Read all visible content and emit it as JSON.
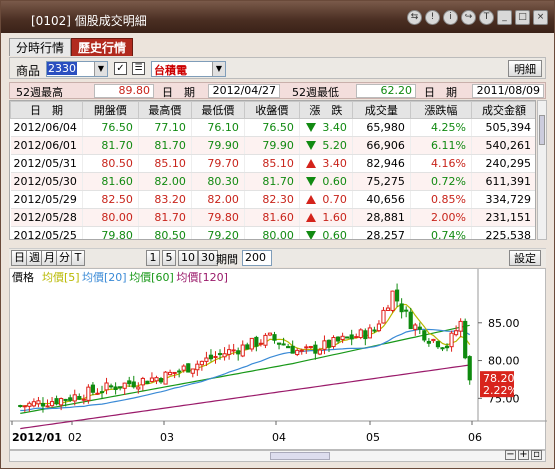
{
  "window": {
    "title": "[0102] 個股成交明細",
    "buttons": [
      "⇆",
      "!",
      "i",
      "↪",
      "T",
      "_",
      "□",
      "×"
    ]
  },
  "tabs": [
    {
      "label": "分時行情",
      "active": false
    },
    {
      "label": "歷史行情",
      "active": true
    }
  ],
  "quote": {
    "stock_label": "商品",
    "stock_code": "2330",
    "stock_name": "台積電",
    "details_button": "明細",
    "checkbox": "✓"
  },
  "stats": {
    "high_label": "52週最高",
    "high_value": "89.80",
    "high_date_label": "日　期",
    "high_date": "2012/04/27",
    "low_label": "52週最低",
    "low_value": "62.20",
    "low_date_label": "日　期",
    "low_date": "2011/08/09"
  },
  "table": {
    "headers": [
      "日　期",
      "開盤價",
      "最高價",
      "最低價",
      "收盤價",
      "漲　跌",
      "成交量",
      "漲跌幅",
      "成交金額"
    ],
    "rows": [
      {
        "date": "2012/06/04",
        "open": "76.50",
        "high": "77.10",
        "low": "76.10",
        "close": "76.50",
        "dir": "down",
        "chg": "3.40",
        "vol": "65,980",
        "pct": "4.25%",
        "amt": "505,394"
      },
      {
        "date": "2012/06/01",
        "open": "81.70",
        "high": "81.70",
        "low": "79.90",
        "close": "79.90",
        "dir": "down",
        "chg": "5.20",
        "vol": "66,906",
        "pct": "6.11%",
        "amt": "540,261"
      },
      {
        "date": "2012/05/31",
        "open": "80.50",
        "high": "85.10",
        "low": "79.70",
        "close": "85.10",
        "dir": "up",
        "chg": "3.40",
        "vol": "82,946",
        "pct": "4.16%",
        "amt": "240,295"
      },
      {
        "date": "2012/05/30",
        "open": "81.60",
        "high": "82.00",
        "low": "80.30",
        "close": "81.70",
        "dir": "down",
        "chg": "0.60",
        "vol": "75,275",
        "pct": "0.72%",
        "amt": "611,391"
      },
      {
        "date": "2012/05/29",
        "open": "82.50",
        "high": "83.20",
        "low": "82.00",
        "close": "82.30",
        "dir": "up",
        "chg": "0.70",
        "vol": "40,656",
        "pct": "0.85%",
        "amt": "334,729"
      },
      {
        "date": "2012/05/28",
        "open": "80.00",
        "high": "81.70",
        "low": "79.80",
        "close": "81.60",
        "dir": "up",
        "chg": "1.60",
        "vol": "28,881",
        "pct": "2.00%",
        "amt": "231,151"
      },
      {
        "date": "2012/05/25",
        "open": "79.80",
        "high": "80.50",
        "low": "79.20",
        "close": "80.00",
        "dir": "down",
        "chg": "0.60",
        "vol": "28,257",
        "pct": "0.74%",
        "amt": "225,538"
      }
    ]
  },
  "chart_toolbar": {
    "period_buttons": [
      "日",
      "週",
      "月",
      "分",
      "T"
    ],
    "range_buttons": [
      "1",
      "5",
      "10",
      "30"
    ],
    "period_label": "期間",
    "period_value": "200",
    "settings_button": "設定"
  },
  "chart_data": {
    "type": "line",
    "legend": [
      {
        "text": "價格",
        "color": "#000000"
      },
      {
        "text": "均價[5]",
        "color": "#b8b800"
      },
      {
        "text": "均價[20]",
        "color": "#3a8ad6"
      },
      {
        "text": "均價[60]",
        "color": "#189818"
      },
      {
        "text": "均價[120]",
        "color": "#9a1a6a"
      }
    ],
    "y_ticks": [
      "85.00",
      "80.00",
      "75.00"
    ],
    "ylim": [
      72,
      90
    ],
    "x_labels": [
      "2012/01",
      "02",
      "03",
      "04",
      "05",
      "06"
    ],
    "last_price": "78.20",
    "last_pct": "2.22%",
    "up_color": "#e0201a",
    "down_color": "#0f8a0f"
  }
}
